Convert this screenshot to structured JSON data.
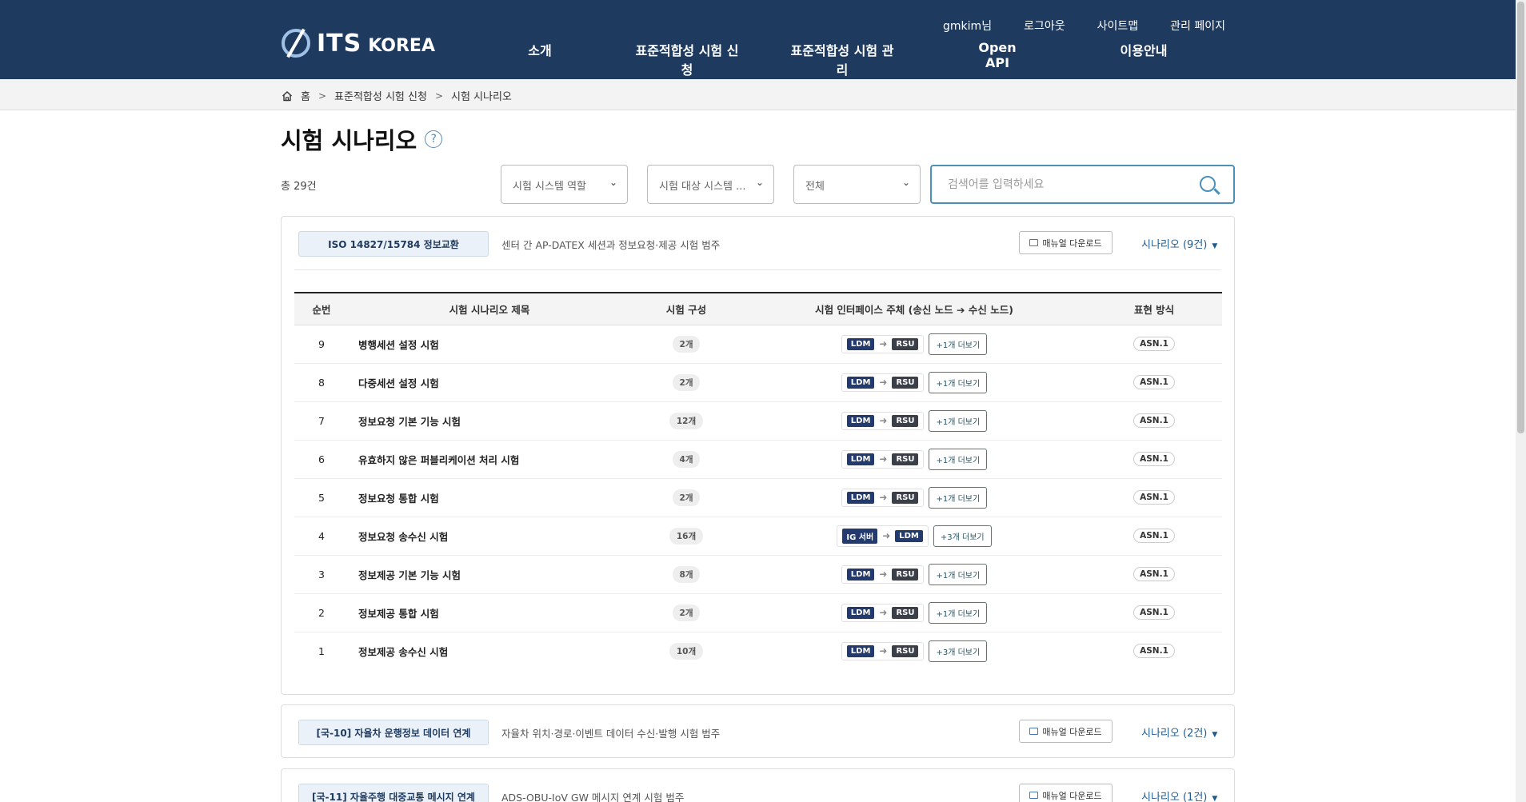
{
  "header": {
    "logo_main": "ITS",
    "logo_sub": "KOREA",
    "util": [
      "gmkim님",
      "로그아웃",
      "사이트맵",
      "관리 페이지"
    ],
    "nav": [
      "소개",
      "표준적합성 시험 신청",
      "표준적합성 시험 관리",
      "Open API",
      "이용안내"
    ]
  },
  "breadcrumb": {
    "home": "홈",
    "level1": "표준적합성 시험 신청",
    "level2": "시험 시나리오"
  },
  "page": {
    "title": "시험 시나리오",
    "help": "?",
    "total": "총 29건"
  },
  "filters": {
    "role": "시험 시스템 역할",
    "target": "시험 대상 시스템 ...",
    "scope": "전체",
    "search_placeholder": "검색어를 입력하세요"
  },
  "table_headers": [
    "순번",
    "시험 시나리오 제목",
    "시험 구성",
    "시험 인터페이스 주체 (송신 노드 ➔ 수신 노드)",
    "표현 방식"
  ],
  "categories": [
    {
      "tag": "ISO 14827/15784 정보교환",
      "desc": "센터 간 AP-DATEX 세션과 정보요청·제공 시험 범주",
      "manual": "매뉴얼 다운로드",
      "toggle": "시나리오 (9건)",
      "rows": [
        {
          "no": "9",
          "title": "병행세션 설정 시험",
          "count": "2개",
          "from": "LDM",
          "to": "RSU",
          "more": "+1개 더보기",
          "expr": "ASN.1"
        },
        {
          "no": "8",
          "title": "다중세션 설정 시험",
          "count": "2개",
          "from": "LDM",
          "to": "RSU",
          "more": "+1개 더보기",
          "expr": "ASN.1"
        },
        {
          "no": "7",
          "title": "정보요청 기본 기능 시험",
          "count": "12개",
          "from": "LDM",
          "to": "RSU",
          "more": "+1개 더보기",
          "expr": "ASN.1"
        },
        {
          "no": "6",
          "title": "유효하지 않은 퍼블리케이션 처리 시험",
          "count": "4개",
          "from": "LDM",
          "to": "RSU",
          "more": "+1개 더보기",
          "expr": "ASN.1"
        },
        {
          "no": "5",
          "title": "정보요청 통합 시험",
          "count": "2개",
          "from": "LDM",
          "to": "RSU",
          "more": "+1개 더보기",
          "expr": "ASN.1"
        },
        {
          "no": "4",
          "title": "정보요청 송수신 시험",
          "count": "16개",
          "from": "IG 서버",
          "to": "LDM",
          "more": "+3개 더보기",
          "expr": "ASN.1"
        },
        {
          "no": "3",
          "title": "정보제공 기본 기능 시험",
          "count": "8개",
          "from": "LDM",
          "to": "RSU",
          "more": "+1개 더보기",
          "expr": "ASN.1"
        },
        {
          "no": "2",
          "title": "정보제공 통합 시험",
          "count": "2개",
          "from": "LDM",
          "to": "RSU",
          "more": "+1개 더보기",
          "expr": "ASN.1"
        },
        {
          "no": "1",
          "title": "정보제공 송수신 시험",
          "count": "10개",
          "from": "LDM",
          "to": "RSU",
          "more": "+3개 더보기",
          "expr": "ASN.1"
        }
      ]
    },
    {
      "tag": "[국-10] 자율차 운행정보 데이터 연계",
      "desc": "자율차 위치·경로·이벤트 데이터 수신·발행 시험 범주",
      "manual": "매뉴얼 다운로드",
      "toggle": "시나리오 (2건)"
    },
    {
      "tag": "[국-11] 자율주행 대중교통 메시지 연계",
      "desc": "ADS-OBU-IoV GW 메시지 연계 시험 범주",
      "manual": "매뉴얼 다운로드",
      "toggle": "시나리오 (1건)"
    }
  ]
}
